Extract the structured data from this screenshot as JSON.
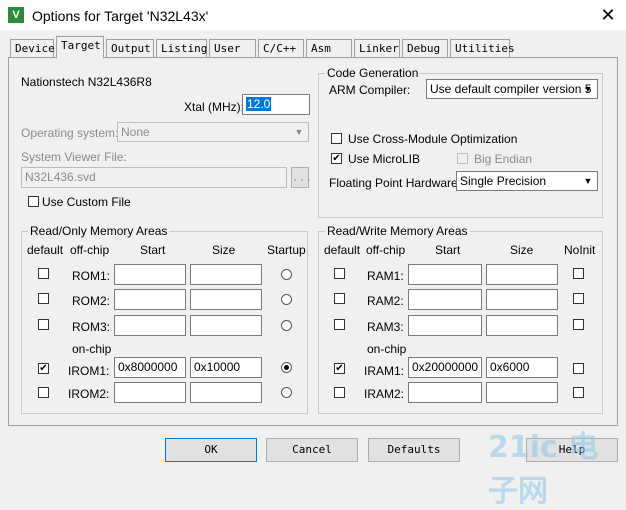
{
  "title": "Options for Target 'N32L43x'",
  "title_icon": "keil-uvision-icon",
  "close_glyph": "✕",
  "tabs": [
    "Device",
    "Target",
    "Output",
    "Listing",
    "User",
    "C/C++",
    "Asm",
    "Linker",
    "Debug",
    "Utilities"
  ],
  "active_tab": "Target",
  "device_name": "Nationstech N32L436R8",
  "xtal_label": "Xtal (MHz):",
  "xtal_value": "12.0",
  "os_label": "Operating system:",
  "os_value": "None",
  "svd_label": "System Viewer File:",
  "svd_value": "N32L436.svd",
  "browse_label": "...",
  "custom_file_label": "Use Custom File",
  "code_gen": {
    "title": "Code Generation",
    "compiler_label": "ARM Compiler:",
    "compiler_value": "Use default compiler version 5",
    "cross_module_label": "Use Cross-Module Optimization",
    "microlib_label": "Use MicroLIB",
    "big_endian_label": "Big Endian",
    "fpu_label": "Floating Point Hardware:",
    "fpu_value": "Single Precision"
  },
  "ro": {
    "title": "Read/Only Memory Areas",
    "headers": {
      "default": "default",
      "offchip": "off-chip",
      "start": "Start",
      "size": "Size",
      "startup": "Startup"
    },
    "onchip_label": "on-chip",
    "rows": [
      {
        "label": "ROM1:",
        "start": "",
        "size": "",
        "default": false,
        "startup": false
      },
      {
        "label": "ROM2:",
        "start": "",
        "size": "",
        "default": false,
        "startup": false
      },
      {
        "label": "ROM3:",
        "start": "",
        "size": "",
        "default": false,
        "startup": false
      },
      {
        "label": "IROM1:",
        "start": "0x8000000",
        "size": "0x10000",
        "default": true,
        "startup": true
      },
      {
        "label": "IROM2:",
        "start": "",
        "size": "",
        "default": false,
        "startup": false
      }
    ]
  },
  "rw": {
    "title": "Read/Write Memory Areas",
    "headers": {
      "default": "default",
      "offchip": "off-chip",
      "start": "Start",
      "size": "Size",
      "noinit": "NoInit"
    },
    "onchip_label": "on-chip",
    "rows": [
      {
        "label": "RAM1:",
        "start": "",
        "size": "",
        "default": false,
        "noinit": false
      },
      {
        "label": "RAM2:",
        "start": "",
        "size": "",
        "default": false,
        "noinit": false
      },
      {
        "label": "RAM3:",
        "start": "",
        "size": "",
        "default": false,
        "noinit": false
      },
      {
        "label": "IRAM1:",
        "start": "0x20000000",
        "size": "0x6000",
        "default": true,
        "noinit": false
      },
      {
        "label": "IRAM2:",
        "start": "",
        "size": "",
        "default": false,
        "noinit": false
      }
    ]
  },
  "buttons": {
    "ok": "OK",
    "cancel": "Cancel",
    "defaults": "Defaults",
    "help": "Help"
  },
  "watermark": "21ic 电子网"
}
